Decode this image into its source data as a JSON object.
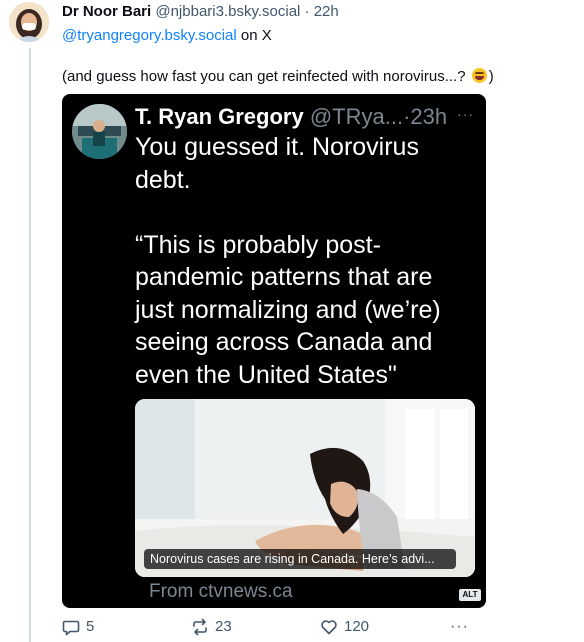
{
  "post": {
    "author_name": "Dr Noor Bari",
    "handle": "@njbbari3.bsky.social",
    "separator": "·",
    "time": "22h",
    "mention": "@tryangregory.bsky.social",
    "mention_suffix": "on X",
    "text": "(and guess how fast you can get reinfected with norovirus...?",
    "text_suffix": ")",
    "emoji_icon": "rolling-on-floor-laughing-emoji"
  },
  "embed": {
    "author_name": "T. Ryan Gregory",
    "handle": "@TRya...",
    "separator": "·",
    "time": "23h",
    "more_glyph": "···",
    "body_line1": "You guessed it. Norovirus debt.",
    "body_line2": "“This is probably post-pandemic patterns that are just normalizing and (we’re) seeing across Canada and even the United States\"",
    "media_caption": "Norovirus cases are rising in Canada. Here’s advi...",
    "link_domain": "From ctvnews.ca",
    "alt_label": "ALT"
  },
  "actions": {
    "reply_count": "5",
    "repost_count": "23",
    "like_count": "120",
    "more_glyph": "···"
  },
  "colors": {
    "accent": "#1083fe",
    "muted": "#42576c",
    "embed_bg": "#000000",
    "thread_line": "#d4dbe2"
  }
}
